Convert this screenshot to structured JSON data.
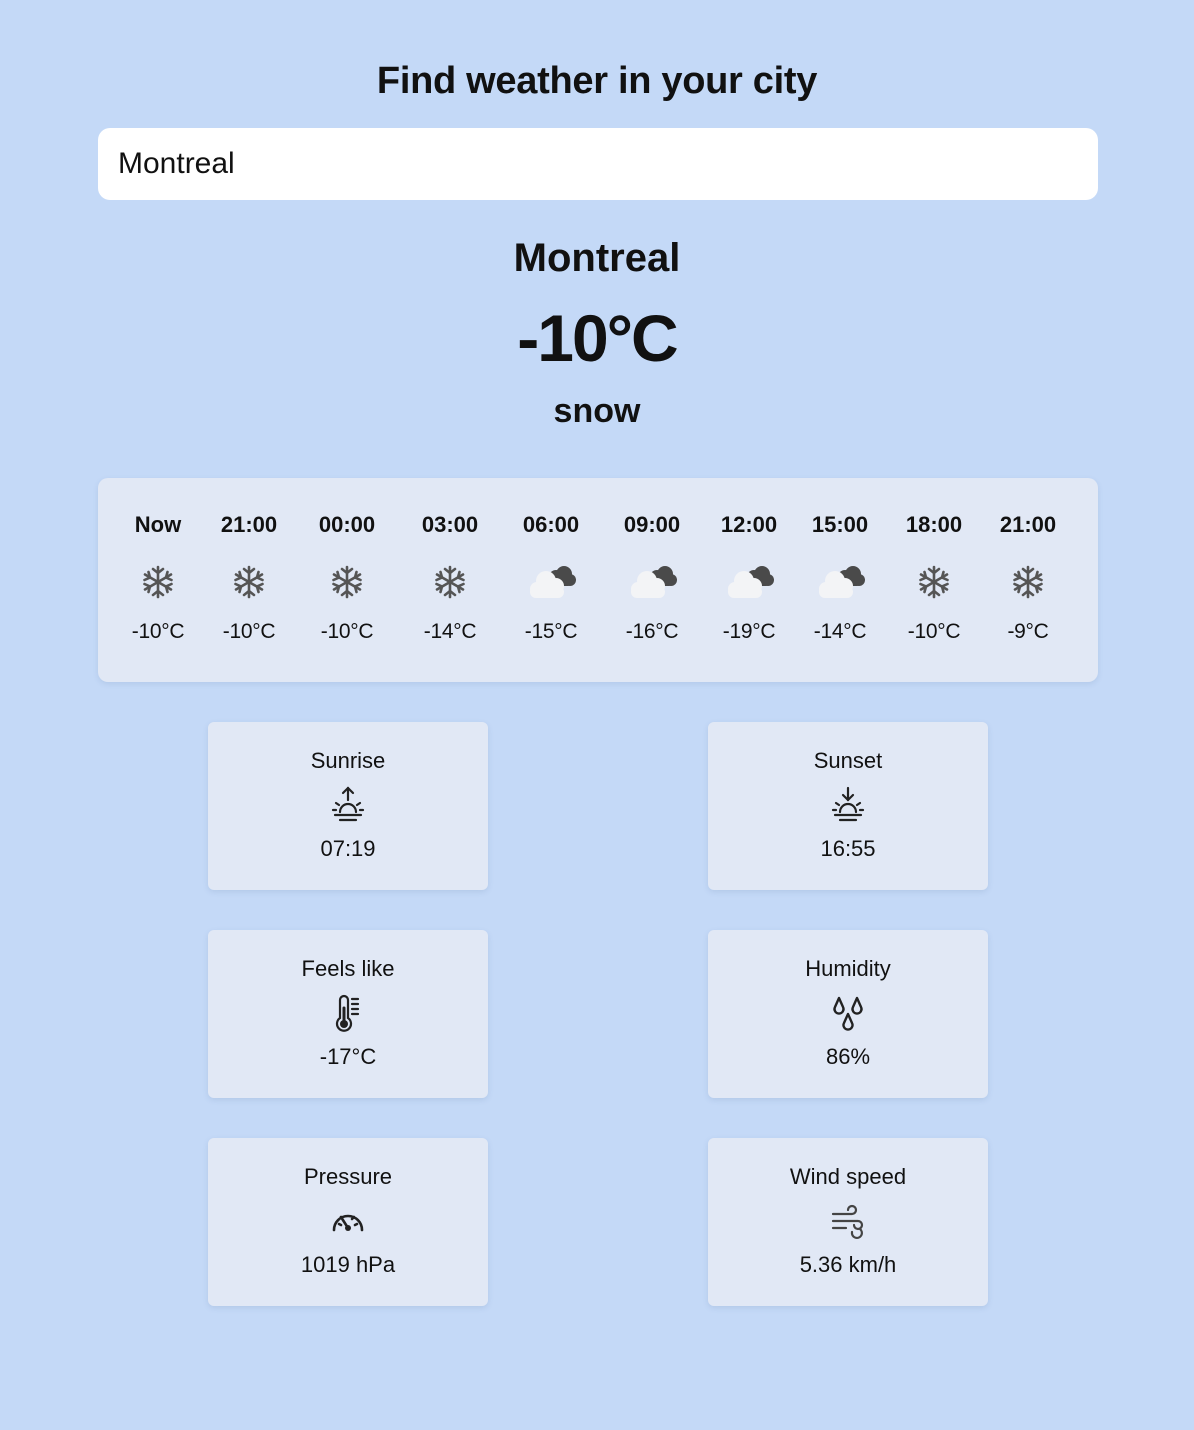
{
  "header": {
    "title": "Find weather in your city"
  },
  "search": {
    "value": "Montreal",
    "placeholder": ""
  },
  "current": {
    "city": "Montreal",
    "temperature": "-10°C",
    "description": "snow"
  },
  "forecast": [
    {
      "time": "Now",
      "icon": "snow-icon",
      "temp": "-10°C"
    },
    {
      "time": "21:00",
      "icon": "snow-icon",
      "temp": "-10°C"
    },
    {
      "time": "00:00",
      "icon": "snow-icon",
      "temp": "-10°C"
    },
    {
      "time": "03:00",
      "icon": "snow-icon",
      "temp": "-14°C"
    },
    {
      "time": "06:00",
      "icon": "cloudy-icon",
      "temp": "-15°C"
    },
    {
      "time": "09:00",
      "icon": "cloudy-icon",
      "temp": "-16°C"
    },
    {
      "time": "12:00",
      "icon": "cloudy-icon",
      "temp": "-19°C"
    },
    {
      "time": "15:00",
      "icon": "cloudy-icon",
      "temp": "-14°C"
    },
    {
      "time": "18:00",
      "icon": "snow-icon",
      "temp": "-10°C"
    },
    {
      "time": "21:00",
      "icon": "snow-icon",
      "temp": "-9°C"
    }
  ],
  "details": {
    "sunrise": {
      "label": "Sunrise",
      "icon": "sunrise-icon",
      "value": "07:19"
    },
    "sunset": {
      "label": "Sunset",
      "icon": "sunset-icon",
      "value": "16:55"
    },
    "feels_like": {
      "label": "Feels like",
      "icon": "thermometer-icon",
      "value": "-17°C"
    },
    "humidity": {
      "label": "Humidity",
      "icon": "humidity-icon",
      "value": "86%"
    },
    "pressure": {
      "label": "Pressure",
      "icon": "gauge-icon",
      "value": "1019 hPa"
    },
    "wind": {
      "label": "Wind speed",
      "icon": "wind-icon",
      "value": "5.36 km/h"
    }
  },
  "colors": {
    "background": "#c4d9f7",
    "card": "#e1e8f5",
    "input": "#ffffff",
    "text": "#111111"
  }
}
